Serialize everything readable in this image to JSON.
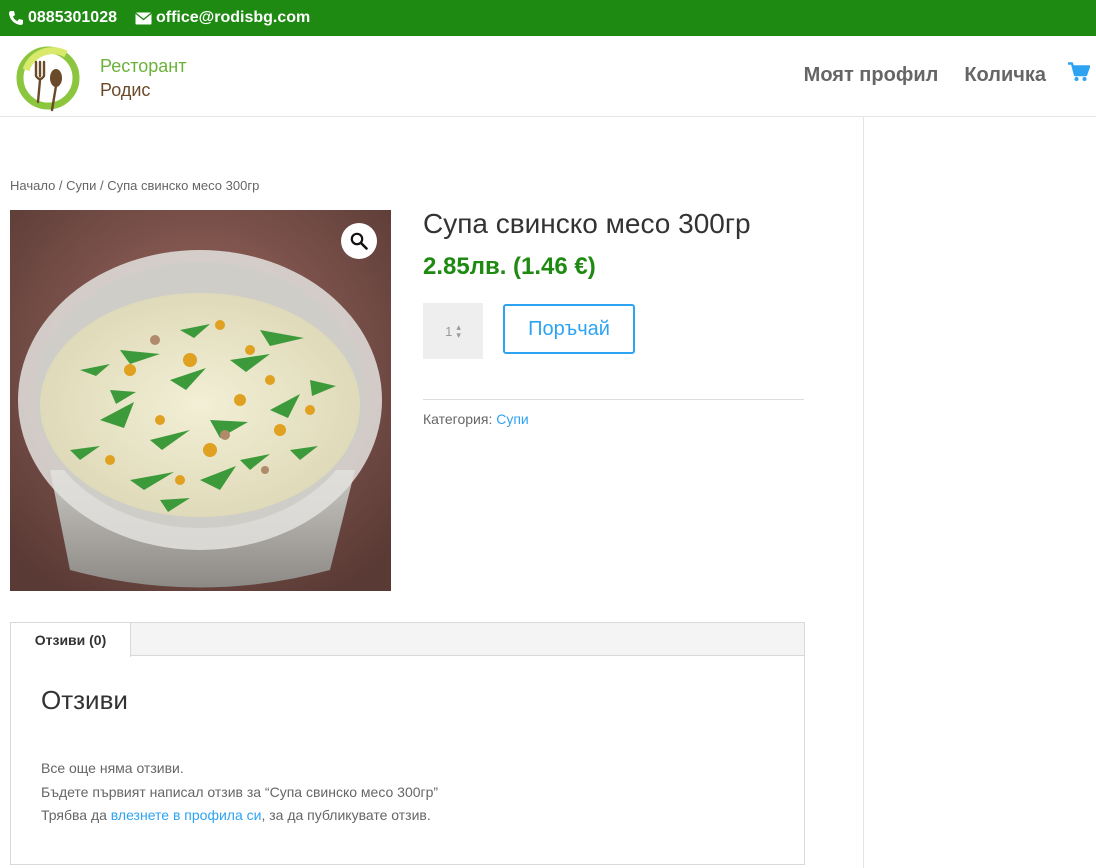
{
  "topbar": {
    "phone": "0885301028",
    "email": "office@rodisbg.com",
    "bg_color": "#1e8a12"
  },
  "logo": {
    "line1": "Ресторант",
    "line2": "Родис"
  },
  "nav": {
    "profile": "Моят профил",
    "cart": "Количка",
    "cart_icon": "shopping-cart-icon"
  },
  "breadcrumb": {
    "home": "Начало",
    "sep1": " / ",
    "category": "Супи",
    "sep2": " / ",
    "current": "Супа свинско месо 300гр"
  },
  "product": {
    "title": "Супа свинско месо 300гр",
    "price": "2.85лв. (1.46 €)",
    "quantity": "1",
    "order_button": "Поръчай",
    "category_label": "Категория: ",
    "category_value": "Супи"
  },
  "tabs": {
    "active": "Отзиви (0)",
    "heading": "Отзиви",
    "no_reviews": "Все още няма отзиви.",
    "first_review": "Бъдете първият написал отзив за “Супа свинско месо 300гр”",
    "login_prefix": "Трябва да ",
    "login_link": "влезнете в профила си",
    "login_suffix": ", за да публикувате отзив."
  },
  "colors": {
    "accent": "#2ea3f2",
    "price": "#1e8a12"
  }
}
